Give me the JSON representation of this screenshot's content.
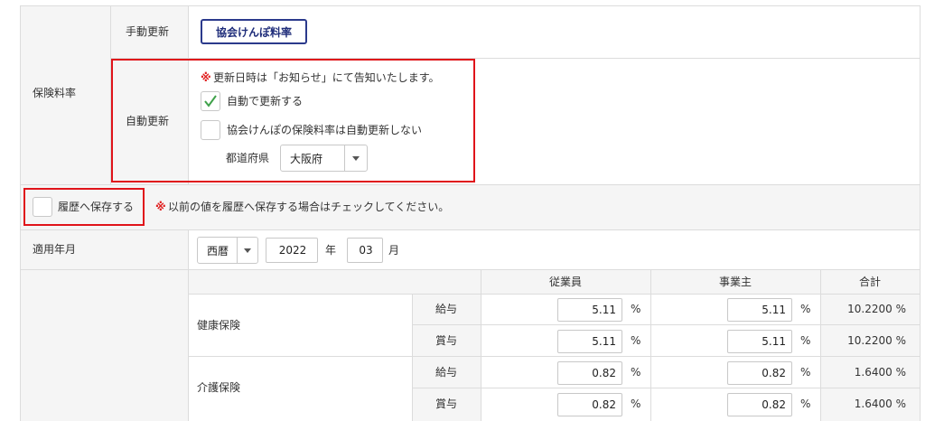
{
  "rows": {
    "manual_label": "手動更新",
    "auto_label": "自動更新",
    "insurance_rate_label": "保険料率",
    "apply_month_label": "適用年月"
  },
  "manual": {
    "button_label": "協会けんぽ料率"
  },
  "auto": {
    "notice_mark": "※",
    "notice_text": "更新日時は「お知らせ」にて告知いたします。",
    "option_auto_update": "自動で更新する",
    "option_no_auto_update": "協会けんぽの保険料率は自動更新しない",
    "prefecture_label": "都道府県",
    "prefecture_value": "大阪府"
  },
  "history": {
    "checkbox_label": "履歴へ保存する",
    "notice_mark": "※",
    "notice_text": "以前の値を履歴へ保存する場合はチェックしてください。"
  },
  "apply_date": {
    "era_value": "西暦",
    "year_value": "2022",
    "year_unit": "年",
    "month_value": "03",
    "month_unit": "月"
  },
  "rate_table": {
    "headers": {
      "employee": "従業員",
      "employer": "事業主",
      "total": "合計"
    },
    "percent_sign": "%",
    "groups": [
      {
        "name": "健康保険",
        "rows": [
          {
            "type": "給与",
            "employee": "5.11",
            "employer": "5.11",
            "total": "10.2200 %"
          },
          {
            "type": "賞与",
            "employee": "5.11",
            "employer": "5.11",
            "total": "10.2200 %"
          }
        ]
      },
      {
        "name": "介護保険",
        "rows": [
          {
            "type": "給与",
            "employee": "0.82",
            "employer": "0.82",
            "total": "1.6400 %"
          },
          {
            "type": "賞与",
            "employee": "0.82",
            "employer": "0.82",
            "total": "1.6400 %"
          }
        ]
      }
    ]
  },
  "colors": {
    "highlight_red": "#e0131a",
    "button_navy": "#1f2d7a",
    "check_green": "#3fa14a"
  }
}
